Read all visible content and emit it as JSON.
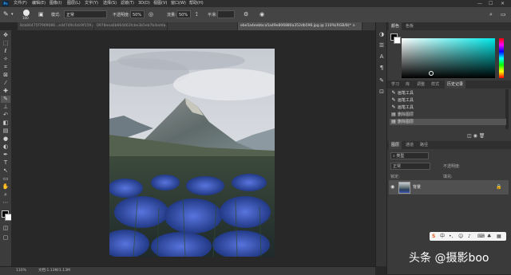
{
  "app": {
    "logo": "Ps"
  },
  "menubar": {
    "items": [
      "文件(F)",
      "编辑(E)",
      "图像(I)",
      "图层(L)",
      "文字(Y)",
      "选择(S)",
      "滤镜(T)",
      "3D(D)",
      "视图(V)",
      "窗口(W)",
      "帮助(H)"
    ],
    "window_controls": [
      "—",
      "☐",
      "✕"
    ]
  },
  "options": {
    "brush_size": "100",
    "mode_label": "模式:",
    "mode_value": "正常",
    "opacity_label": "不透明度:",
    "opacity_value": "50%",
    "flow_label": "流量:",
    "flow_value": "50%",
    "smooth_label": "平滑:"
  },
  "doc_tabs": [
    "8cb84475f7969086...e44749c4dc9f159.jpg @ 100%...",
    "0978eea6b664463fcbe3b5eb7b4edda.jpg @ 100%(R...",
    "ebe5a4eebbca5a49e806880a352db596.jpg @ 110%(RGB/8)* ×",
    ""
  ],
  "status": {
    "zoom": "110%",
    "doc_size": "文档:1.13M/1.13M"
  },
  "panels": {
    "color_tabs": [
      "颜色",
      "色板"
    ],
    "history_tabs": [
      "学习",
      "库",
      "调整",
      "样式",
      "历史记录"
    ],
    "history_items": [
      "画笔工具",
      "画笔工具",
      "画笔工具",
      "删除图层",
      "删除图层"
    ],
    "layers_tabs": [
      "图层",
      "通道",
      "路径"
    ],
    "layer_kind": "类型",
    "blend_mode": "正常",
    "opacity_label": "不透明度:",
    "lock_label": "锁定:",
    "fill_label": "填充:",
    "layer_name": "背景"
  },
  "watermark": {
    "text": "头条 @摄影boo"
  },
  "ime": {
    "brand": "S",
    "lang": "中"
  }
}
